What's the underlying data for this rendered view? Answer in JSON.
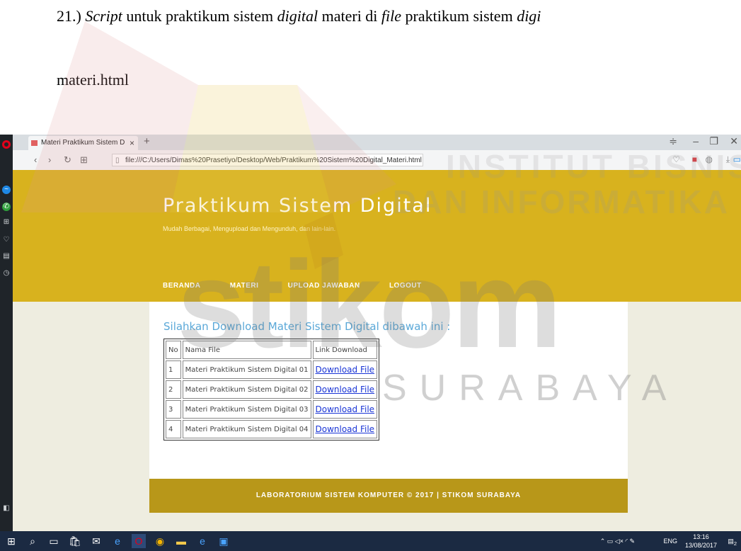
{
  "document": {
    "line1_number": "21.)",
    "line1_word1": "Script",
    "line1_text2": "untuk praktikum sistem",
    "line1_word2": "digital",
    "line1_text3": "materi di",
    "line1_word3": "file",
    "line1_text4": "praktikum sistem",
    "line1_word4": "digi",
    "line2": "materi.html"
  },
  "browser": {
    "tab_title": "Materi Praktikum Sistem D",
    "tab_close": "×",
    "new_tab": "+",
    "url": "file:///C:/Users/Dimas%20Prasetiyo/Desktop/Web/Praktikum%20Sistem%20Digital_Materi.html"
  },
  "site": {
    "title": "Praktikum Sistem Digital",
    "subtitle": "Mudah Berbagai, Mengupload dan Mengunduh, dan lain-lain.",
    "nav": [
      "BERANDA",
      "MATERI",
      "UPLOAD JAWABAN",
      "LOGOUT"
    ],
    "heading": "Silahkan Download Materi Sistem Digital dibawah ini :",
    "table": {
      "headers": [
        "No",
        "Nama File",
        "Link Download"
      ],
      "rows": [
        {
          "no": "1",
          "name": "Materi Praktikum Sistem Digital 01",
          "link": "Download File"
        },
        {
          "no": "2",
          "name": "Materi Praktikum Sistem Digital 02",
          "link": "Download File"
        },
        {
          "no": "3",
          "name": "Materi Praktikum Sistem Digital 03",
          "link": "Download File"
        },
        {
          "no": "4",
          "name": "Materi Praktikum Sistem Digital 04",
          "link": "Download File"
        }
      ]
    },
    "footer": "LABORATORIUM SISTEM KOMPUTER © 2017 | STIKOM SURABAYA"
  },
  "taskbar": {
    "language": "ENG",
    "time": "13:16",
    "date": "13/08/2017",
    "notification_count": "2"
  },
  "watermark": {
    "line1": "INSTITUT BISNIS",
    "line2": "DAN INFORMATIKA",
    "logo": "stikom",
    "city": "SURABAYA"
  },
  "colors": {
    "header": "#d8b21e",
    "footer": "#b89719",
    "heading": "#5aa8d8",
    "link": "#1a35d6"
  }
}
